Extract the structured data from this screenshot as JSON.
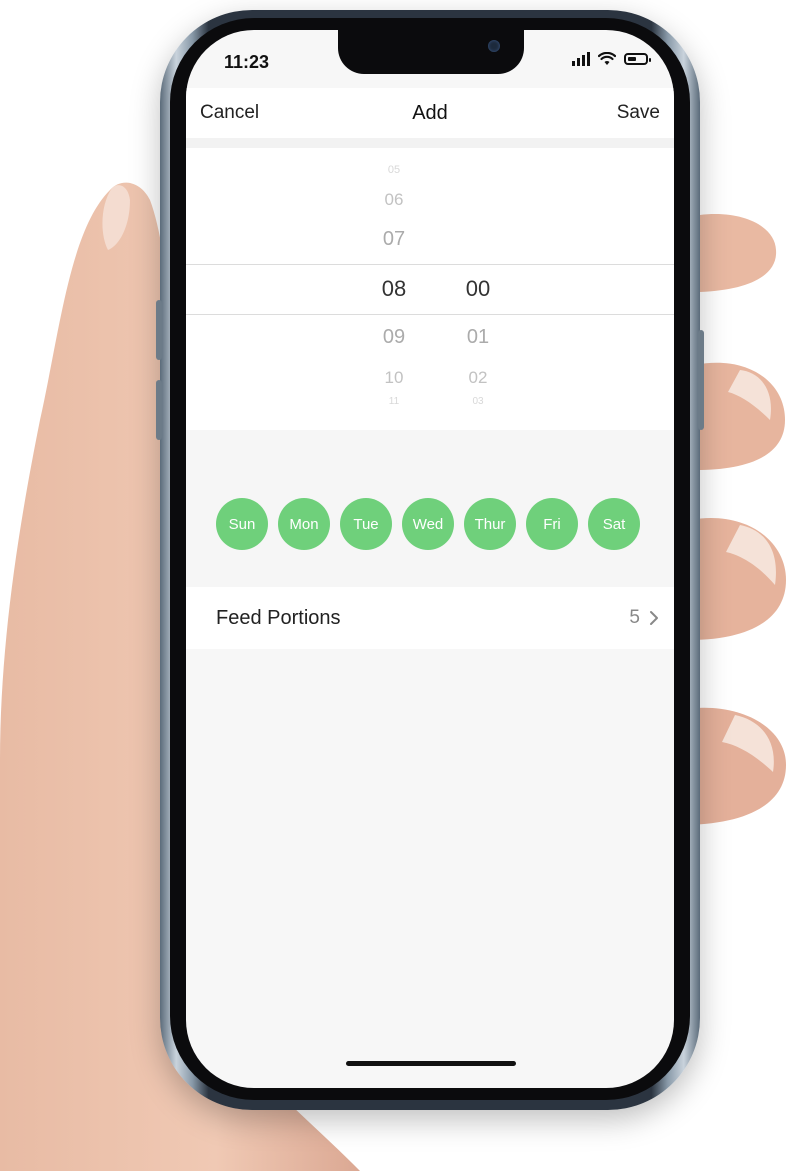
{
  "status_bar": {
    "time": "11:23"
  },
  "nav": {
    "cancel_label": "Cancel",
    "title": "Add",
    "save_label": "Save"
  },
  "time_picker": {
    "hours": [
      "05",
      "06",
      "07",
      "08",
      "09",
      "10",
      "11"
    ],
    "minutes": [
      "00",
      "01",
      "02",
      "03"
    ],
    "selected_hour": "08",
    "selected_minute": "00"
  },
  "days": [
    {
      "label": "Sun"
    },
    {
      "label": "Mon"
    },
    {
      "label": "Tue"
    },
    {
      "label": "Wed"
    },
    {
      "label": "Thur"
    },
    {
      "label": "Fri"
    },
    {
      "label": "Sat"
    }
  ],
  "feed_portions": {
    "label": "Feed Portions",
    "value": "5"
  },
  "colors": {
    "day_selected": "#6fd07b",
    "background": "#f7f7f7"
  },
  "icons": [
    "signal-icon",
    "wifi-icon",
    "battery-icon",
    "chevron-right-icon"
  ]
}
